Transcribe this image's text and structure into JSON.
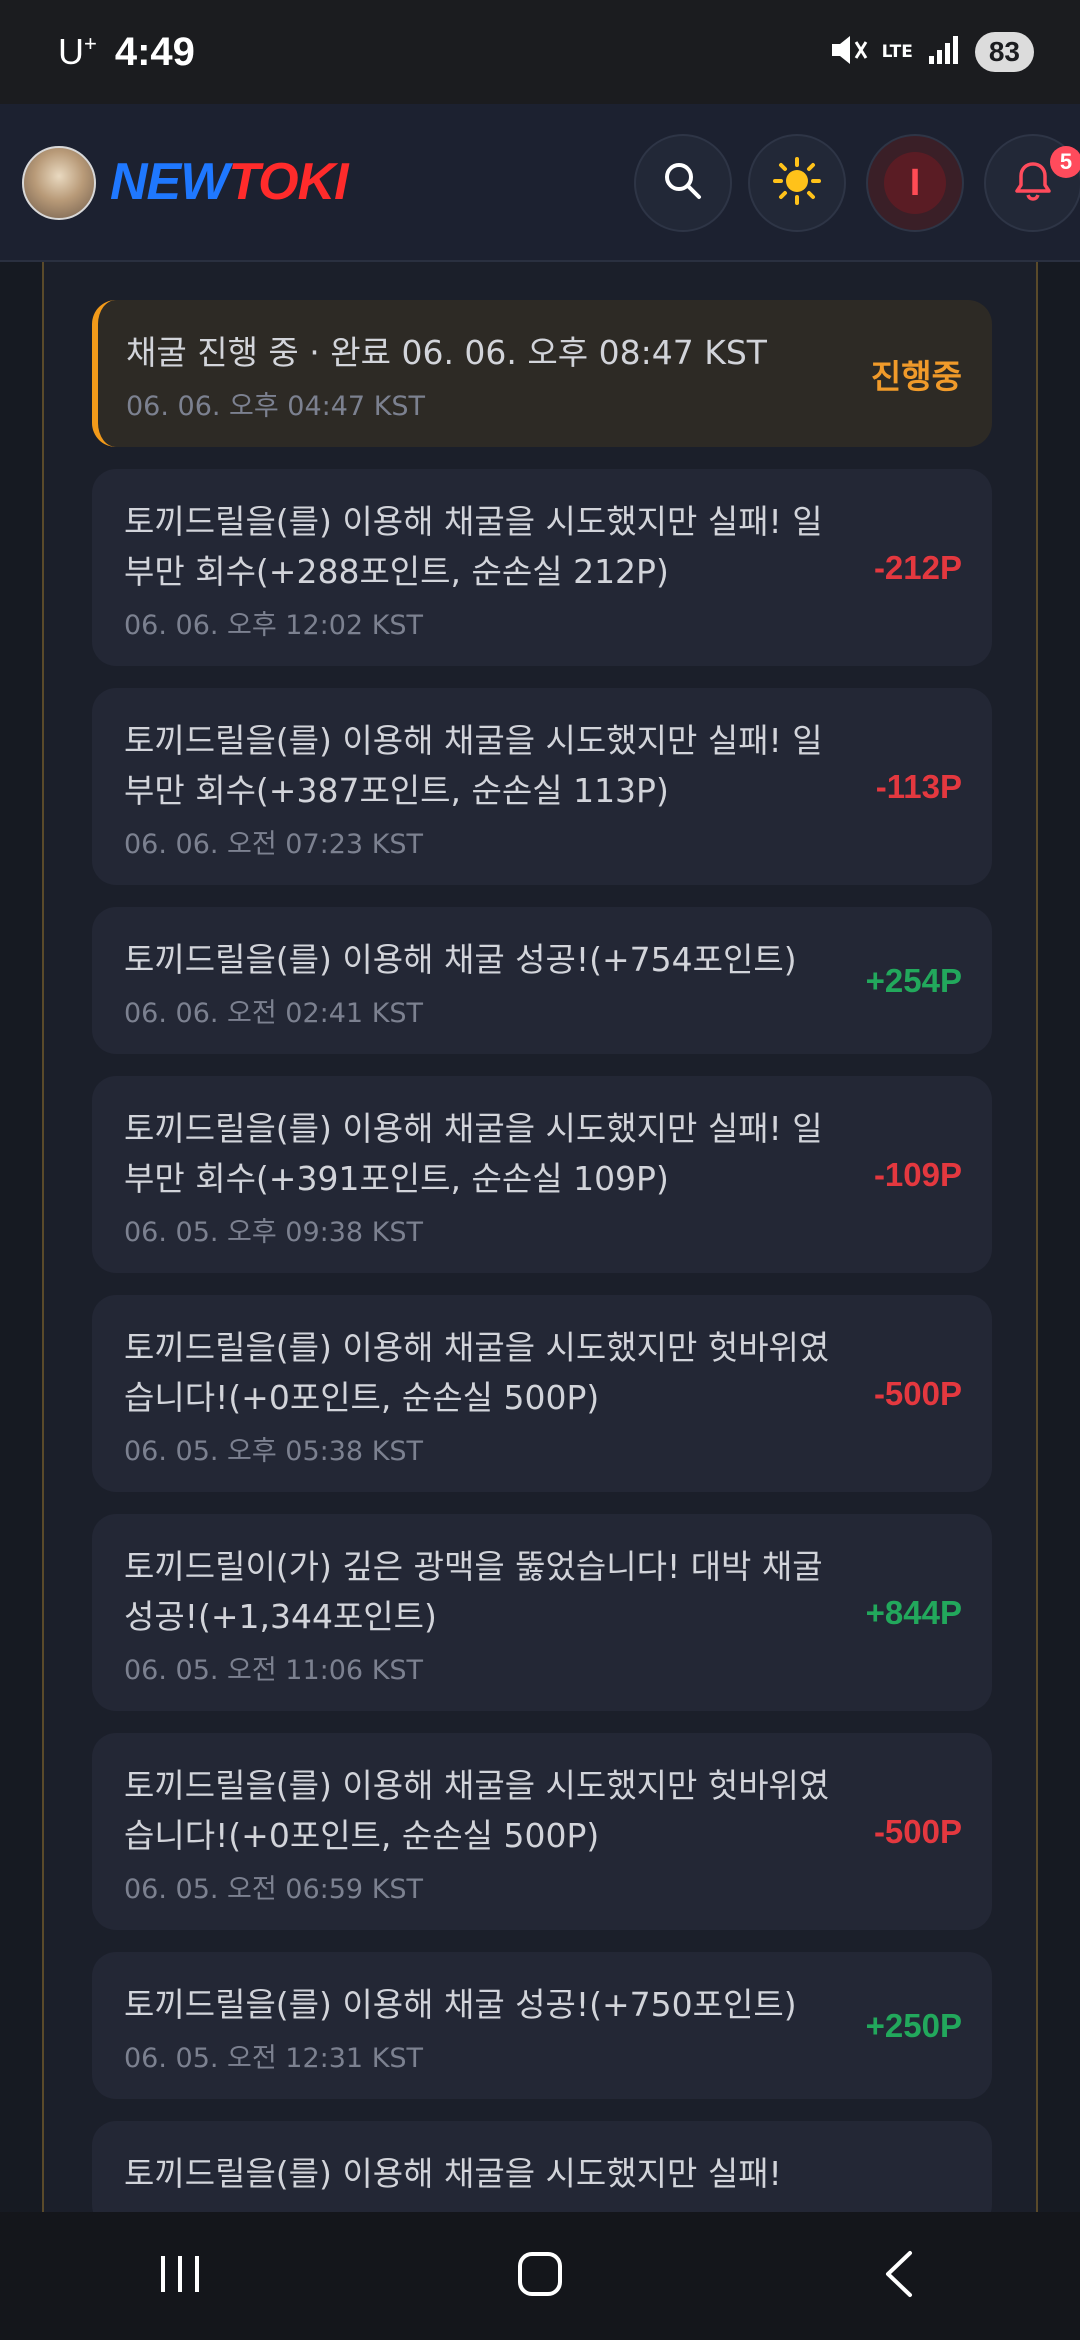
{
  "status_bar": {
    "carrier": "U",
    "carrier_sup": "+",
    "time": "4:49",
    "network": "LTE",
    "battery": "83"
  },
  "header": {
    "logo_part1": "NEW",
    "logo_part2": "TOKI",
    "user_initial": "I",
    "notification_count": "5"
  },
  "transactions": [
    {
      "message": "채굴 진행 중 · 완료 06. 06. 오후 08:47 KST",
      "timestamp": "06. 06. 오후 04:47 KST",
      "amount": "진행중",
      "kind": "progress"
    },
    {
      "message": "토끼드릴을(를) 이용해 채굴을 시도했지만 실패! 일부만 회수(+288포인트, 순손실 212P)",
      "timestamp": "06. 06. 오후 12:02 KST",
      "amount": "-212P",
      "kind": "neg"
    },
    {
      "message": "토끼드릴을(를) 이용해 채굴을 시도했지만 실패! 일부만 회수(+387포인트, 순손실 113P)",
      "timestamp": "06. 06. 오전 07:23 KST",
      "amount": "-113P",
      "kind": "neg"
    },
    {
      "message": "토끼드릴을(를) 이용해 채굴 성공!(+754포인트)",
      "timestamp": "06. 06. 오전 02:41 KST",
      "amount": "+254P",
      "kind": "pos"
    },
    {
      "message": "토끼드릴을(를) 이용해 채굴을 시도했지만 실패! 일부만 회수(+391포인트, 순손실 109P)",
      "timestamp": "06. 05. 오후 09:38 KST",
      "amount": "-109P",
      "kind": "neg"
    },
    {
      "message": "토끼드릴을(를) 이용해 채굴을 시도했지만 헛바위였습니다!(+0포인트, 순손실 500P)",
      "timestamp": "06. 05. 오후 05:38 KST",
      "amount": "-500P",
      "kind": "neg"
    },
    {
      "message": "토끼드릴이(가) 깊은 광맥을 뚫었습니다! 대박 채굴 성공!(+1,344포인트)",
      "timestamp": "06. 05. 오전 11:06 KST",
      "amount": "+844P",
      "kind": "pos"
    },
    {
      "message": "토끼드릴을(를) 이용해 채굴을 시도했지만 헛바위였습니다!(+0포인트, 순손실 500P)",
      "timestamp": "06. 05. 오전 06:59 KST",
      "amount": "-500P",
      "kind": "neg"
    },
    {
      "message": "토끼드릴을(를) 이용해 채굴 성공!(+750포인트)",
      "timestamp": "06. 05. 오전 12:31 KST",
      "amount": "+250P",
      "kind": "pos"
    },
    {
      "message": "토끼드릴을(를) 이용해 채굴을 시도했지만 실패!",
      "timestamp": "",
      "amount": "",
      "kind": "neg"
    }
  ]
}
